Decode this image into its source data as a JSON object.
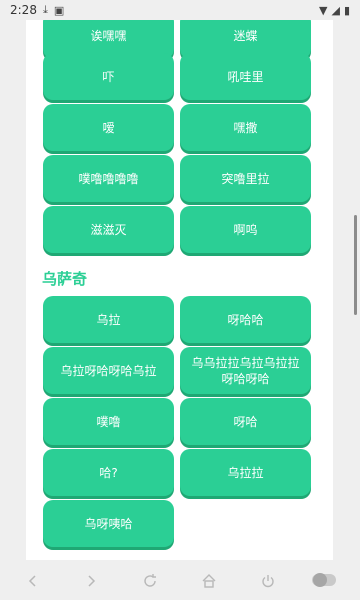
{
  "status_bar": {
    "time": "2:28",
    "icons": [
      "download-icon",
      "notification-a-icon",
      "wifi-icon",
      "signal-icon",
      "battery-icon"
    ]
  },
  "buttons_top": [
    {
      "label": "诶嘿嘿"
    },
    {
      "label": "迷蝶"
    },
    {
      "label": "吓"
    },
    {
      "label": "吼哇里"
    },
    {
      "label": "嗳"
    },
    {
      "label": "嘿撒"
    },
    {
      "label": "噗噜噜噜噜"
    },
    {
      "label": "突噜里拉"
    },
    {
      "label": "滋滋灭"
    },
    {
      "label": "啊呜"
    }
  ],
  "section": {
    "title": "乌萨奇"
  },
  "buttons_bottom": [
    {
      "label": "乌拉"
    },
    {
      "label": "呀哈哈"
    },
    {
      "label": "乌拉呀哈呀哈乌拉"
    },
    {
      "label": "乌乌拉拉乌拉乌拉拉呀哈呀哈"
    },
    {
      "label": "噗噜"
    },
    {
      "label": "呀哈"
    },
    {
      "label": "哈?"
    },
    {
      "label": "乌拉拉"
    },
    {
      "label": "乌呀咦哈"
    }
  ],
  "nav": {
    "items": [
      "back-icon",
      "forward-icon",
      "reload-icon",
      "home-icon",
      "power-icon",
      "toggle-icon"
    ]
  },
  "colors": {
    "accent": "#2bcf95",
    "accent_shadow": "#1fa874",
    "background": "#efefef",
    "card": "#ffffff"
  }
}
